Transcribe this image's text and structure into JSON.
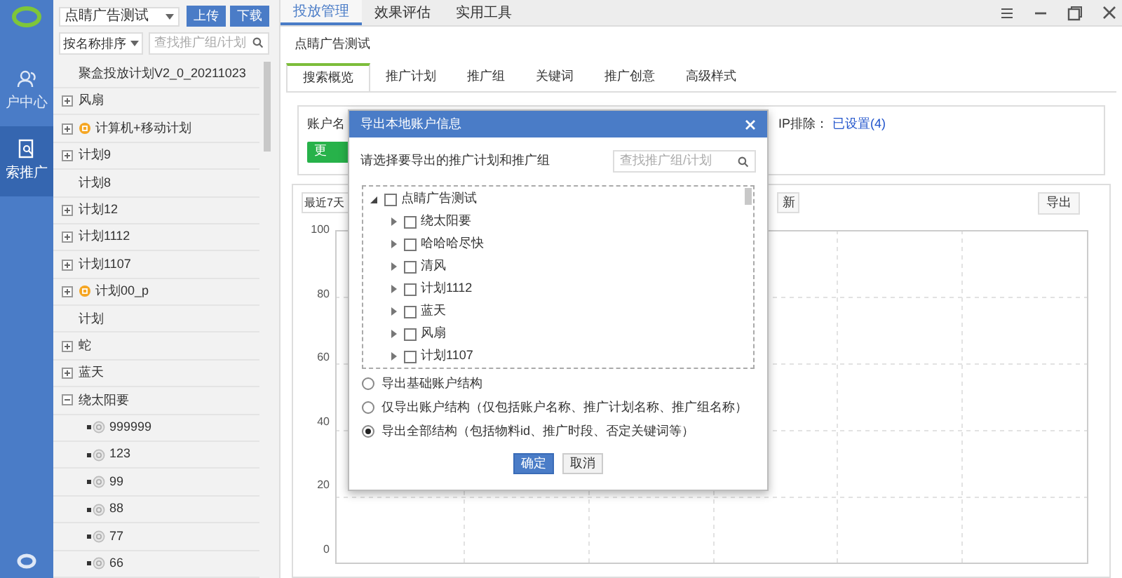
{
  "nav": {
    "items": [
      {
        "label": "户中心",
        "selected": false,
        "kind": "people"
      },
      {
        "label": "索推广",
        "selected": true,
        "kind": "search"
      }
    ]
  },
  "sidebar": {
    "account_select": "点睛广告测试",
    "buttons": [
      "上传",
      "下载"
    ],
    "sort_select": "按名称排序",
    "search": {
      "placeholder": "查找推广组/计划"
    },
    "items": [
      {
        "label": "聚盒投放计划V2_0_20211023",
        "kind": "leaf",
        "paused": false
      },
      {
        "label": "风扇",
        "kind": "collapsed",
        "paused": false
      },
      {
        "label": "计算机+移动计划",
        "kind": "collapsed",
        "paused": true
      },
      {
        "label": "计划9",
        "kind": "collapsed",
        "paused": false
      },
      {
        "label": "计划8",
        "kind": "leaf",
        "paused": false
      },
      {
        "label": "计划12",
        "kind": "collapsed",
        "paused": false
      },
      {
        "label": "计划1112",
        "kind": "collapsed",
        "paused": false
      },
      {
        "label": "计划1107",
        "kind": "collapsed",
        "paused": false
      },
      {
        "label": "计划00_p",
        "kind": "collapsed",
        "paused": true
      },
      {
        "label": "计划",
        "kind": "leaf",
        "paused": false
      },
      {
        "label": "蛇",
        "kind": "collapsed",
        "paused": false
      },
      {
        "label": "蓝天",
        "kind": "collapsed",
        "paused": false
      },
      {
        "label": "绕太阳要",
        "kind": "expanded",
        "paused": false,
        "children": [
          {
            "label": "999999"
          },
          {
            "label": "123"
          },
          {
            "label": "99"
          },
          {
            "label": "88"
          },
          {
            "label": "77"
          },
          {
            "label": "66"
          }
        ]
      }
    ]
  },
  "top_tabs": [
    {
      "label": "投放管理",
      "selected": true
    },
    {
      "label": "效果评估",
      "selected": false
    },
    {
      "label": "实用工具",
      "selected": false
    }
  ],
  "account_title": "点睛广告测试",
  "tabs": [
    {
      "label": "搜索概览",
      "selected": true
    },
    {
      "label": "推广计划",
      "selected": false
    },
    {
      "label": "推广组",
      "selected": false
    },
    {
      "label": "关键词",
      "selected": false
    },
    {
      "label": "推广创意",
      "selected": false
    },
    {
      "label": "高级样式",
      "selected": false
    }
  ],
  "info": {
    "account_label": "账户名",
    "update_button": "更",
    "ip_label": "IP排除：",
    "ip_link": "已设置(4)"
  },
  "chart_panel": {
    "range_select": "最近7天",
    "refresh_button": "新",
    "export_button": "导出",
    "y_labels": [
      "100",
      "80",
      "60",
      "40",
      "20",
      "0"
    ]
  },
  "dialog": {
    "title": "导出本地账户信息",
    "prompt": "请选择要导出的推广计划和推广组",
    "search": {
      "placeholder": "查找推广组/计划"
    },
    "tree": {
      "label": "点睛广告测试",
      "checked": false,
      "expanded": true,
      "children": [
        {
          "label": "绕太阳要",
          "checked": false,
          "expanded": false
        },
        {
          "label": "哈哈哈尽快",
          "checked": false,
          "expanded": false
        },
        {
          "label": "清风",
          "checked": false,
          "expanded": false
        },
        {
          "label": "计划1112",
          "checked": false,
          "expanded": false
        },
        {
          "label": "蓝天",
          "checked": false,
          "expanded": false
        },
        {
          "label": "风扇",
          "checked": false,
          "expanded": false
        },
        {
          "label": "计划1107",
          "checked": false,
          "expanded": false
        }
      ]
    },
    "options": [
      {
        "label": "导出基础账户结构",
        "selected": false
      },
      {
        "label": "仅导出账户结构（仅包括账户名称、推广计划名称、推广组名称）",
        "selected": false
      },
      {
        "label": "导出全部结构（包括物料id、推广时段、否定关键词等）",
        "selected": true
      }
    ],
    "buttons": [
      {
        "label": "确定",
        "kind": "primary"
      },
      {
        "label": "取消",
        "kind": "secondary"
      }
    ]
  }
}
